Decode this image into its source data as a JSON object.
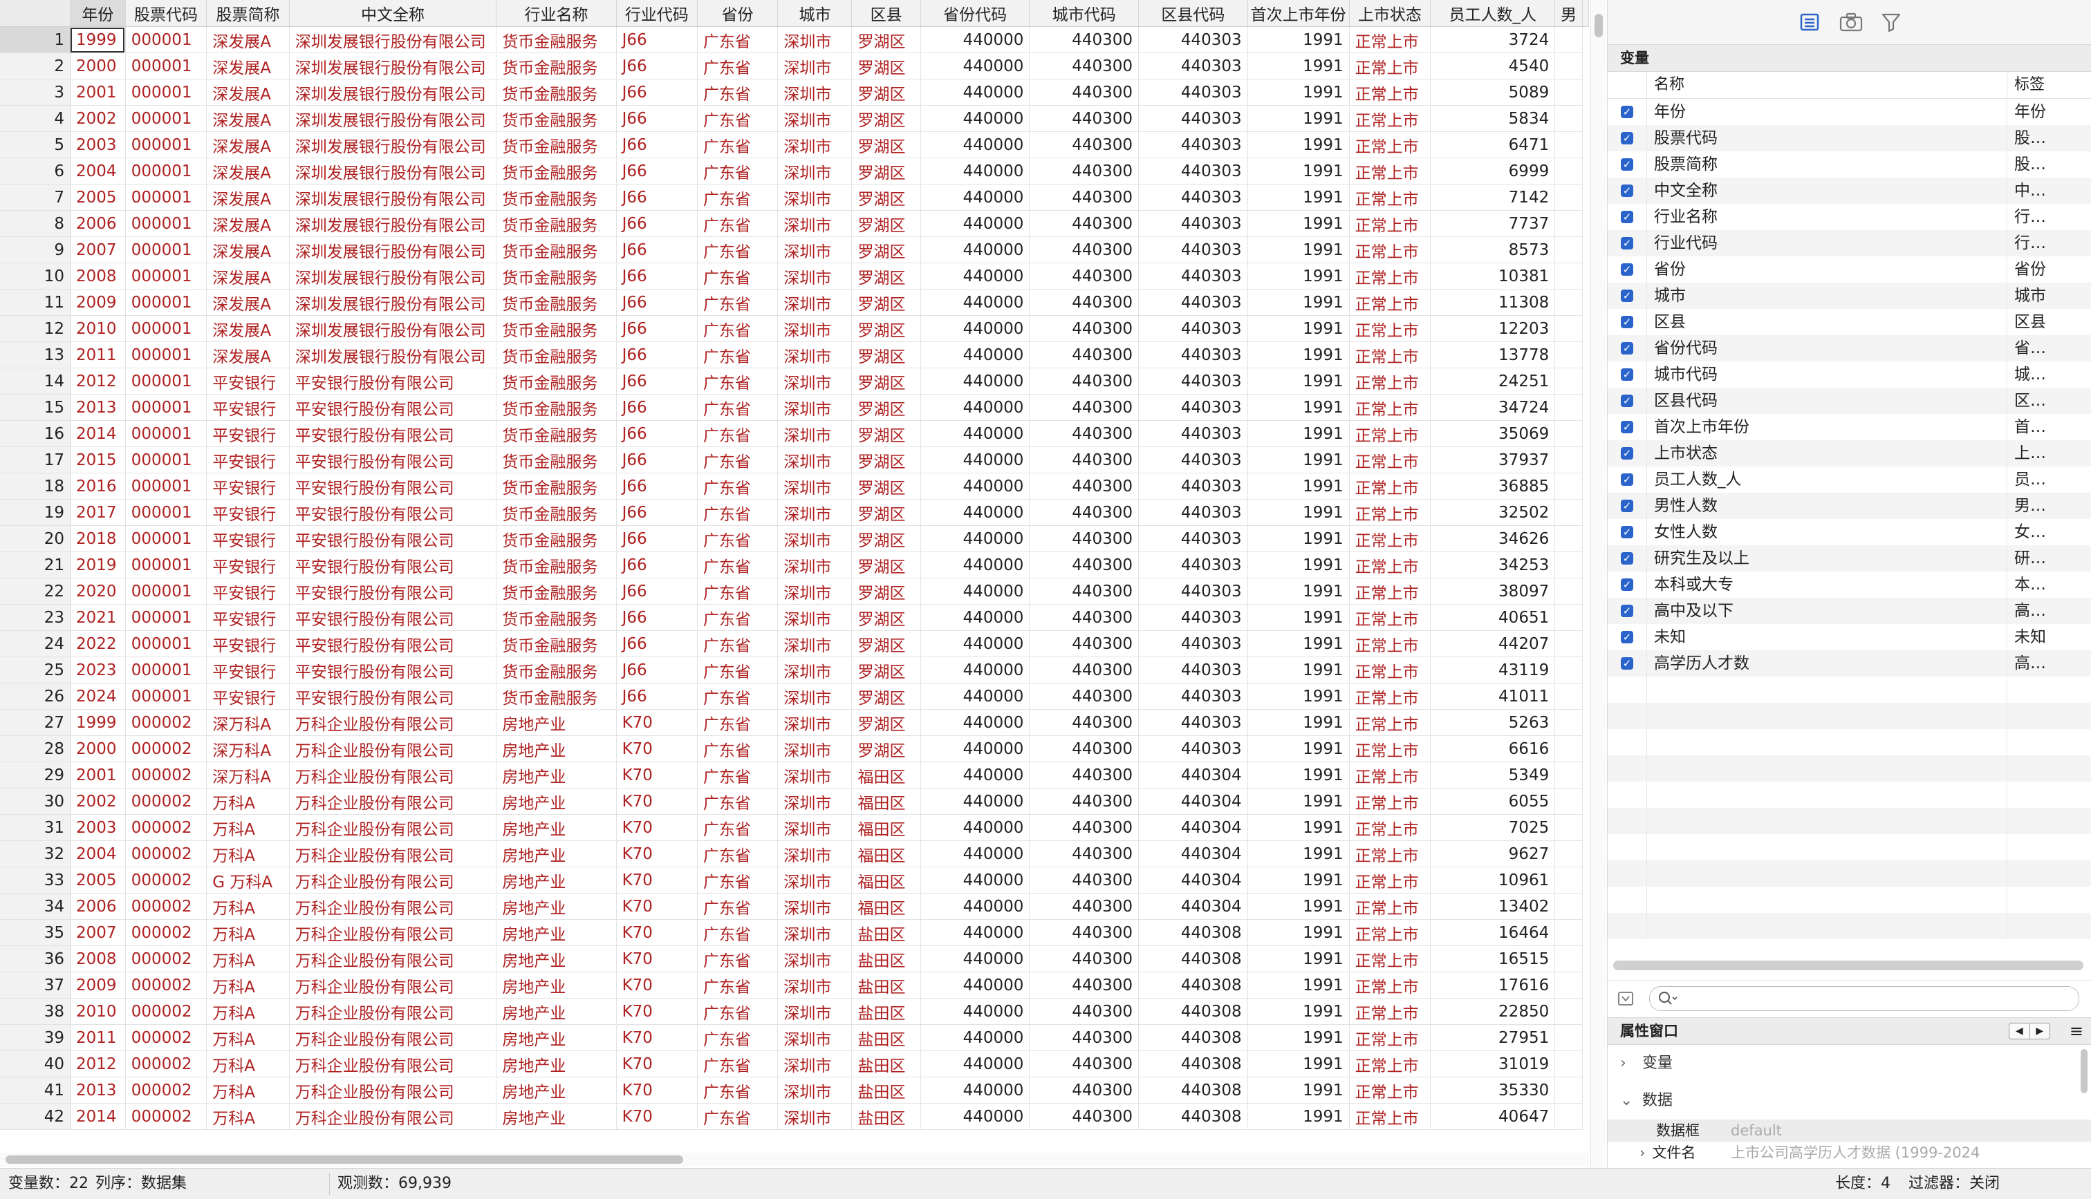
{
  "grid": {
    "columns": [
      "年份",
      "股票代码",
      "股票简称",
      "中文全称",
      "行业名称",
      "行业代码",
      "省份",
      "城市",
      "区县",
      "省份代码",
      "城市代码",
      "区县代码",
      "首次上市年份",
      "上市状态",
      "员工人数_人",
      "男"
    ],
    "rows": [
      [
        "1",
        "1999",
        "000001",
        "深发展A",
        "深圳发展银行股份有限公司",
        "货币金融服务",
        "J66",
        "广东省",
        "深圳市",
        "罗湖区",
        "440000",
        "440300",
        "440303",
        "1991",
        "正常上市",
        "3724"
      ],
      [
        "2",
        "2000",
        "000001",
        "深发展A",
        "深圳发展银行股份有限公司",
        "货币金融服务",
        "J66",
        "广东省",
        "深圳市",
        "罗湖区",
        "440000",
        "440300",
        "440303",
        "1991",
        "正常上市",
        "4540"
      ],
      [
        "3",
        "2001",
        "000001",
        "深发展A",
        "深圳发展银行股份有限公司",
        "货币金融服务",
        "J66",
        "广东省",
        "深圳市",
        "罗湖区",
        "440000",
        "440300",
        "440303",
        "1991",
        "正常上市",
        "5089"
      ],
      [
        "4",
        "2002",
        "000001",
        "深发展A",
        "深圳发展银行股份有限公司",
        "货币金融服务",
        "J66",
        "广东省",
        "深圳市",
        "罗湖区",
        "440000",
        "440300",
        "440303",
        "1991",
        "正常上市",
        "5834"
      ],
      [
        "5",
        "2003",
        "000001",
        "深发展A",
        "深圳发展银行股份有限公司",
        "货币金融服务",
        "J66",
        "广东省",
        "深圳市",
        "罗湖区",
        "440000",
        "440300",
        "440303",
        "1991",
        "正常上市",
        "6471"
      ],
      [
        "6",
        "2004",
        "000001",
        "深发展A",
        "深圳发展银行股份有限公司",
        "货币金融服务",
        "J66",
        "广东省",
        "深圳市",
        "罗湖区",
        "440000",
        "440300",
        "440303",
        "1991",
        "正常上市",
        "6999"
      ],
      [
        "7",
        "2005",
        "000001",
        "深发展A",
        "深圳发展银行股份有限公司",
        "货币金融服务",
        "J66",
        "广东省",
        "深圳市",
        "罗湖区",
        "440000",
        "440300",
        "440303",
        "1991",
        "正常上市",
        "7142"
      ],
      [
        "8",
        "2006",
        "000001",
        "深发展A",
        "深圳发展银行股份有限公司",
        "货币金融服务",
        "J66",
        "广东省",
        "深圳市",
        "罗湖区",
        "440000",
        "440300",
        "440303",
        "1991",
        "正常上市",
        "7737"
      ],
      [
        "9",
        "2007",
        "000001",
        "深发展A",
        "深圳发展银行股份有限公司",
        "货币金融服务",
        "J66",
        "广东省",
        "深圳市",
        "罗湖区",
        "440000",
        "440300",
        "440303",
        "1991",
        "正常上市",
        "8573"
      ],
      [
        "10",
        "2008",
        "000001",
        "深发展A",
        "深圳发展银行股份有限公司",
        "货币金融服务",
        "J66",
        "广东省",
        "深圳市",
        "罗湖区",
        "440000",
        "440300",
        "440303",
        "1991",
        "正常上市",
        "10381"
      ],
      [
        "11",
        "2009",
        "000001",
        "深发展A",
        "深圳发展银行股份有限公司",
        "货币金融服务",
        "J66",
        "广东省",
        "深圳市",
        "罗湖区",
        "440000",
        "440300",
        "440303",
        "1991",
        "正常上市",
        "11308"
      ],
      [
        "12",
        "2010",
        "000001",
        "深发展A",
        "深圳发展银行股份有限公司",
        "货币金融服务",
        "J66",
        "广东省",
        "深圳市",
        "罗湖区",
        "440000",
        "440300",
        "440303",
        "1991",
        "正常上市",
        "12203"
      ],
      [
        "13",
        "2011",
        "000001",
        "深发展A",
        "深圳发展银行股份有限公司",
        "货币金融服务",
        "J66",
        "广东省",
        "深圳市",
        "罗湖区",
        "440000",
        "440300",
        "440303",
        "1991",
        "正常上市",
        "13778"
      ],
      [
        "14",
        "2012",
        "000001",
        "平安银行",
        "平安银行股份有限公司",
        "货币金融服务",
        "J66",
        "广东省",
        "深圳市",
        "罗湖区",
        "440000",
        "440300",
        "440303",
        "1991",
        "正常上市",
        "24251"
      ],
      [
        "15",
        "2013",
        "000001",
        "平安银行",
        "平安银行股份有限公司",
        "货币金融服务",
        "J66",
        "广东省",
        "深圳市",
        "罗湖区",
        "440000",
        "440300",
        "440303",
        "1991",
        "正常上市",
        "34724"
      ],
      [
        "16",
        "2014",
        "000001",
        "平安银行",
        "平安银行股份有限公司",
        "货币金融服务",
        "J66",
        "广东省",
        "深圳市",
        "罗湖区",
        "440000",
        "440300",
        "440303",
        "1991",
        "正常上市",
        "35069"
      ],
      [
        "17",
        "2015",
        "000001",
        "平安银行",
        "平安银行股份有限公司",
        "货币金融服务",
        "J66",
        "广东省",
        "深圳市",
        "罗湖区",
        "440000",
        "440300",
        "440303",
        "1991",
        "正常上市",
        "37937"
      ],
      [
        "18",
        "2016",
        "000001",
        "平安银行",
        "平安银行股份有限公司",
        "货币金融服务",
        "J66",
        "广东省",
        "深圳市",
        "罗湖区",
        "440000",
        "440300",
        "440303",
        "1991",
        "正常上市",
        "36885"
      ],
      [
        "19",
        "2017",
        "000001",
        "平安银行",
        "平安银行股份有限公司",
        "货币金融服务",
        "J66",
        "广东省",
        "深圳市",
        "罗湖区",
        "440000",
        "440300",
        "440303",
        "1991",
        "正常上市",
        "32502"
      ],
      [
        "20",
        "2018",
        "000001",
        "平安银行",
        "平安银行股份有限公司",
        "货币金融服务",
        "J66",
        "广东省",
        "深圳市",
        "罗湖区",
        "440000",
        "440300",
        "440303",
        "1991",
        "正常上市",
        "34626"
      ],
      [
        "21",
        "2019",
        "000001",
        "平安银行",
        "平安银行股份有限公司",
        "货币金融服务",
        "J66",
        "广东省",
        "深圳市",
        "罗湖区",
        "440000",
        "440300",
        "440303",
        "1991",
        "正常上市",
        "34253"
      ],
      [
        "22",
        "2020",
        "000001",
        "平安银行",
        "平安银行股份有限公司",
        "货币金融服务",
        "J66",
        "广东省",
        "深圳市",
        "罗湖区",
        "440000",
        "440300",
        "440303",
        "1991",
        "正常上市",
        "38097"
      ],
      [
        "23",
        "2021",
        "000001",
        "平安银行",
        "平安银行股份有限公司",
        "货币金融服务",
        "J66",
        "广东省",
        "深圳市",
        "罗湖区",
        "440000",
        "440300",
        "440303",
        "1991",
        "正常上市",
        "40651"
      ],
      [
        "24",
        "2022",
        "000001",
        "平安银行",
        "平安银行股份有限公司",
        "货币金融服务",
        "J66",
        "广东省",
        "深圳市",
        "罗湖区",
        "440000",
        "440300",
        "440303",
        "1991",
        "正常上市",
        "44207"
      ],
      [
        "25",
        "2023",
        "000001",
        "平安银行",
        "平安银行股份有限公司",
        "货币金融服务",
        "J66",
        "广东省",
        "深圳市",
        "罗湖区",
        "440000",
        "440300",
        "440303",
        "1991",
        "正常上市",
        "43119"
      ],
      [
        "26",
        "2024",
        "000001",
        "平安银行",
        "平安银行股份有限公司",
        "货币金融服务",
        "J66",
        "广东省",
        "深圳市",
        "罗湖区",
        "440000",
        "440300",
        "440303",
        "1991",
        "正常上市",
        "41011"
      ],
      [
        "27",
        "1999",
        "000002",
        "深万科A",
        "万科企业股份有限公司",
        "房地产业",
        "K70",
        "广东省",
        "深圳市",
        "罗湖区",
        "440000",
        "440300",
        "440303",
        "1991",
        "正常上市",
        "5263"
      ],
      [
        "28",
        "2000",
        "000002",
        "深万科A",
        "万科企业股份有限公司",
        "房地产业",
        "K70",
        "广东省",
        "深圳市",
        "罗湖区",
        "440000",
        "440300",
        "440303",
        "1991",
        "正常上市",
        "6616"
      ],
      [
        "29",
        "2001",
        "000002",
        "深万科A",
        "万科企业股份有限公司",
        "房地产业",
        "K70",
        "广东省",
        "深圳市",
        "福田区",
        "440000",
        "440300",
        "440304",
        "1991",
        "正常上市",
        "5349"
      ],
      [
        "30",
        "2002",
        "000002",
        "万科A",
        "万科企业股份有限公司",
        "房地产业",
        "K70",
        "广东省",
        "深圳市",
        "福田区",
        "440000",
        "440300",
        "440304",
        "1991",
        "正常上市",
        "6055"
      ],
      [
        "31",
        "2003",
        "000002",
        "万科A",
        "万科企业股份有限公司",
        "房地产业",
        "K70",
        "广东省",
        "深圳市",
        "福田区",
        "440000",
        "440300",
        "440304",
        "1991",
        "正常上市",
        "7025"
      ],
      [
        "32",
        "2004",
        "000002",
        "万科A",
        "万科企业股份有限公司",
        "房地产业",
        "K70",
        "广东省",
        "深圳市",
        "福田区",
        "440000",
        "440300",
        "440304",
        "1991",
        "正常上市",
        "9627"
      ],
      [
        "33",
        "2005",
        "000002",
        "G 万科A",
        "万科企业股份有限公司",
        "房地产业",
        "K70",
        "广东省",
        "深圳市",
        "福田区",
        "440000",
        "440300",
        "440304",
        "1991",
        "正常上市",
        "10961"
      ],
      [
        "34",
        "2006",
        "000002",
        "万科A",
        "万科企业股份有限公司",
        "房地产业",
        "K70",
        "广东省",
        "深圳市",
        "福田区",
        "440000",
        "440300",
        "440304",
        "1991",
        "正常上市",
        "13402"
      ],
      [
        "35",
        "2007",
        "000002",
        "万科A",
        "万科企业股份有限公司",
        "房地产业",
        "K70",
        "广东省",
        "深圳市",
        "盐田区",
        "440000",
        "440300",
        "440308",
        "1991",
        "正常上市",
        "16464"
      ],
      [
        "36",
        "2008",
        "000002",
        "万科A",
        "万科企业股份有限公司",
        "房地产业",
        "K70",
        "广东省",
        "深圳市",
        "盐田区",
        "440000",
        "440300",
        "440308",
        "1991",
        "正常上市",
        "16515"
      ],
      [
        "37",
        "2009",
        "000002",
        "万科A",
        "万科企业股份有限公司",
        "房地产业",
        "K70",
        "广东省",
        "深圳市",
        "盐田区",
        "440000",
        "440300",
        "440308",
        "1991",
        "正常上市",
        "17616"
      ],
      [
        "38",
        "2010",
        "000002",
        "万科A",
        "万科企业股份有限公司",
        "房地产业",
        "K70",
        "广东省",
        "深圳市",
        "盐田区",
        "440000",
        "440300",
        "440308",
        "1991",
        "正常上市",
        "22850"
      ],
      [
        "39",
        "2011",
        "000002",
        "万科A",
        "万科企业股份有限公司",
        "房地产业",
        "K70",
        "广东省",
        "深圳市",
        "盐田区",
        "440000",
        "440300",
        "440308",
        "1991",
        "正常上市",
        "27951"
      ],
      [
        "40",
        "2012",
        "000002",
        "万科A",
        "万科企业股份有限公司",
        "房地产业",
        "K70",
        "广东省",
        "深圳市",
        "盐田区",
        "440000",
        "440300",
        "440308",
        "1991",
        "正常上市",
        "31019"
      ],
      [
        "41",
        "2013",
        "000002",
        "万科A",
        "万科企业股份有限公司",
        "房地产业",
        "K70",
        "广东省",
        "深圳市",
        "盐田区",
        "440000",
        "440300",
        "440308",
        "1991",
        "正常上市",
        "35330"
      ],
      [
        "42",
        "2014",
        "000002",
        "万科A",
        "万科企业股份有限公司",
        "房地产业",
        "K70",
        "广东省",
        "深圳市",
        "盐田区",
        "440000",
        "440300",
        "440308",
        "1991",
        "正常上市",
        "40647"
      ]
    ]
  },
  "colors": {
    "string_text": "#b02121",
    "checkbox": "#2a63c9",
    "grid_header_bg": "#f2f2f2"
  },
  "toolbar": {
    "icons": [
      "variables-view-icon",
      "snapshot-camera-icon",
      "filter-funnel-icon"
    ]
  },
  "variables_panel": {
    "title": "变量",
    "col_name": "名称",
    "col_label": "标签",
    "items": [
      {
        "name": "年份",
        "label": "年份"
      },
      {
        "name": "股票代码",
        "label": "股…"
      },
      {
        "name": "股票简称",
        "label": "股…"
      },
      {
        "name": "中文全称",
        "label": "中…"
      },
      {
        "name": "行业名称",
        "label": "行…"
      },
      {
        "name": "行业代码",
        "label": "行…"
      },
      {
        "name": "省份",
        "label": "省份"
      },
      {
        "name": "城市",
        "label": "城市"
      },
      {
        "name": "区县",
        "label": "区县"
      },
      {
        "name": "省份代码",
        "label": "省…"
      },
      {
        "name": "城市代码",
        "label": "城…"
      },
      {
        "name": "区县代码",
        "label": "区…"
      },
      {
        "name": "首次上市年份",
        "label": "首…"
      },
      {
        "name": "上市状态",
        "label": "上…"
      },
      {
        "name": "员工人数_人",
        "label": "员…"
      },
      {
        "name": "男性人数",
        "label": "男…"
      },
      {
        "name": "女性人数",
        "label": "女…"
      },
      {
        "name": "研究生及以上",
        "label": "研…"
      },
      {
        "name": "本科或大专",
        "label": "本…"
      },
      {
        "name": "高中及以下",
        "label": "高…"
      },
      {
        "name": "未知",
        "label": "未知"
      },
      {
        "name": "高学历人才数",
        "label": "高…"
      }
    ],
    "search_placeholder": ""
  },
  "properties_panel": {
    "title": "属性窗口",
    "sections": [
      "变量",
      "数据"
    ],
    "data_frame_key": "数据框",
    "data_frame_value": "default",
    "filename_key": "文件名",
    "filename_value": "上市公司高学历人才数据 (1999-2024"
  },
  "status": {
    "var_count": "变量数：22",
    "order": "列序：数据集",
    "obs_count": "观测数：69,939",
    "length": "长度：4",
    "filter": "过滤器：关闭"
  }
}
